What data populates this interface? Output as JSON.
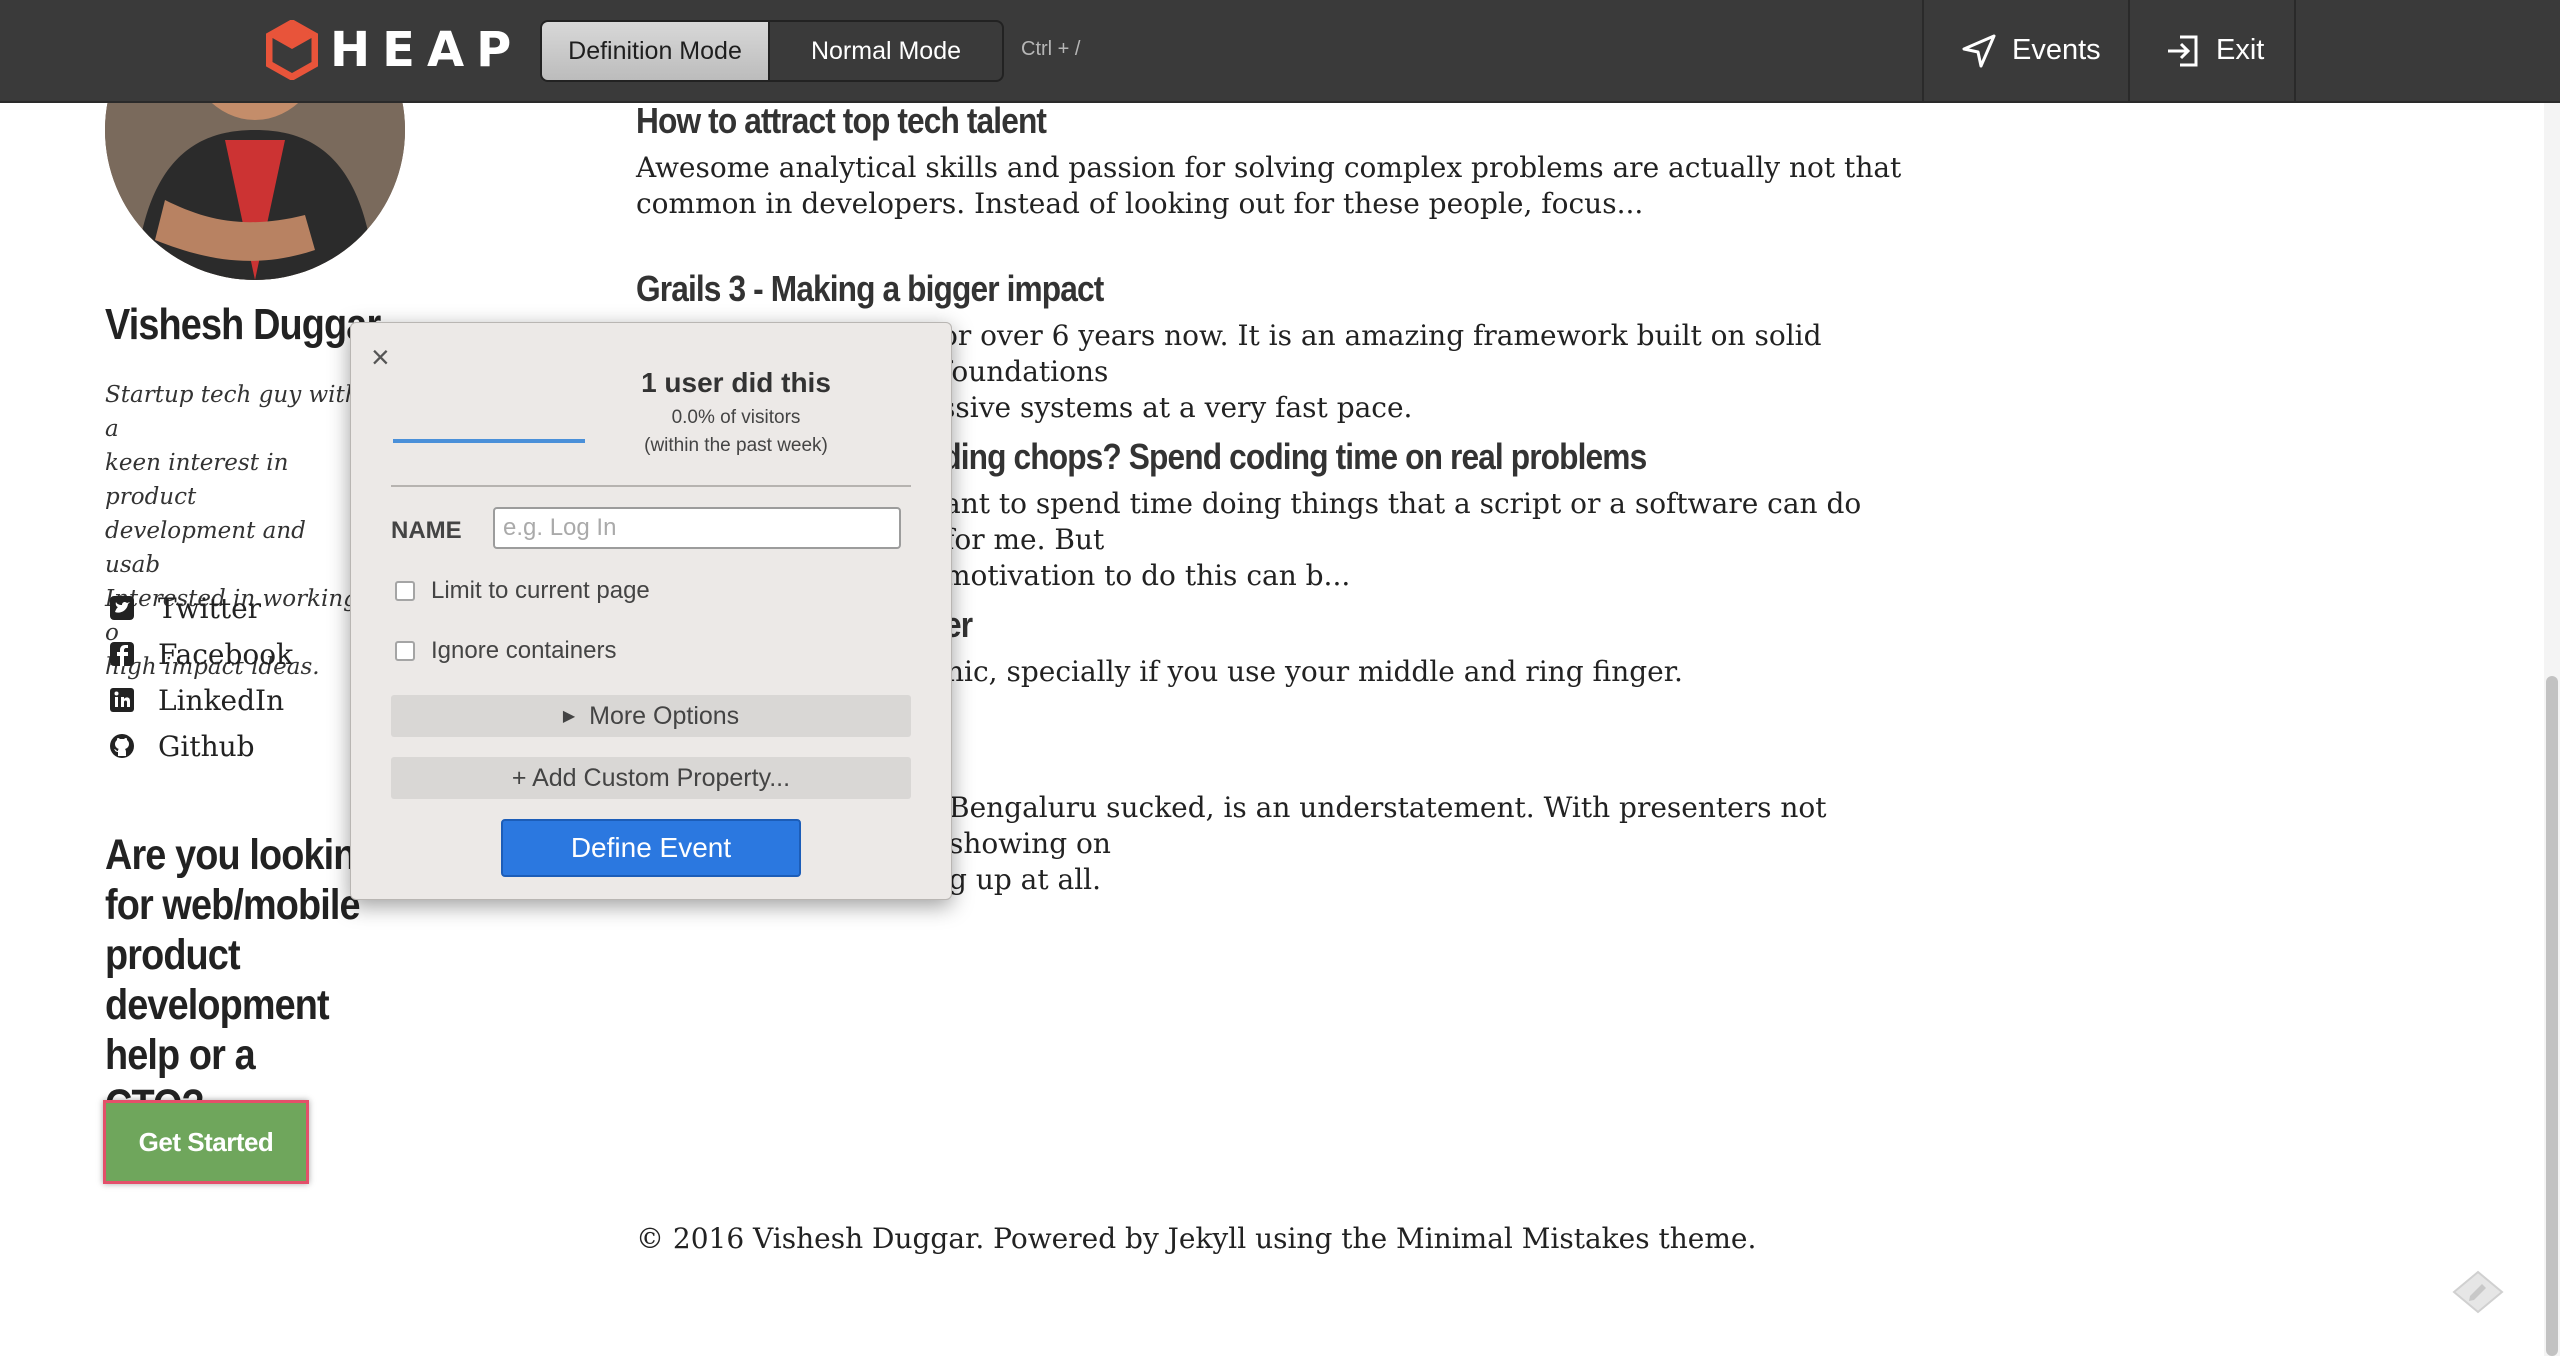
{
  "toolbar": {
    "logo_text": "HEAP",
    "modes": {
      "definition": "Definition Mode",
      "normal": "Normal Mode"
    },
    "shortcut": "Ctrl + /",
    "events_label": "Events",
    "exit_label": "Exit",
    "brand_color": "#e8543a"
  },
  "sidebar": {
    "author_name": "Vishesh Duggar",
    "bio": "Startup tech guy with a\nkeen interest in product\ndevelopment and usab\nInterested in working o\nhigh impact ideas.",
    "social": [
      {
        "label": "Twitter",
        "icon": "twitter-icon"
      },
      {
        "label": "Facebook",
        "icon": "facebook-icon"
      },
      {
        "label": "LinkedIn",
        "icon": "linkedin-icon"
      },
      {
        "label": "Github",
        "icon": "github-icon"
      }
    ],
    "cta_heading": "Are you lookin\nfor web/mobile\nproduct\ndevelopment\nhelp or a CTO?",
    "cta_button": "Get Started"
  },
  "posts": [
    {
      "title": "How to attract top tech talent",
      "excerpt": "Awesome analytical skills and passion for solving complex problems are actually not that common in developers. Instead of looking out for these people, focus..."
    },
    {
      "title": "Grails 3 - Making a bigger impact",
      "excerpt": "or over 6 years now. It is an amazing framework built on solid foundations\nssive systems at a very fast pace."
    },
    {
      "title": "coding chops? Spend coding time on real problems",
      "excerpt": "ant to spend time doing things that a script or a software can do for me. But\n motivation to do this can b..."
    },
    {
      "title": "nger",
      "excerpt": "nic, specially if you use your middle and ring finger."
    },
    {
      "title": "",
      "excerpt": "Bengaluru sucked, is an understatement. With presenters not showing on\ng up at all."
    }
  ],
  "footer": "© 2016 Vishesh Duggar. Powered by Jekyll using the Minimal Mistakes theme.",
  "popup": {
    "close": "×",
    "count": "1 user did this",
    "percent": "0.0% of visitors",
    "period": "(within the past week)",
    "name_label": "NAME",
    "name_placeholder": "e.g. Log In",
    "name_value": "",
    "limit_label": "Limit to current page",
    "limit_checked": false,
    "ignore_label": "Ignore containers",
    "ignore_checked": false,
    "more_options": "More Options",
    "add_property": "+ Add Custom Property...",
    "define_button": "Define Event"
  },
  "colors": {
    "accent_blue": "#2b78e0",
    "cta_green": "#6fa65c",
    "highlight_pink": "#e3506a"
  }
}
